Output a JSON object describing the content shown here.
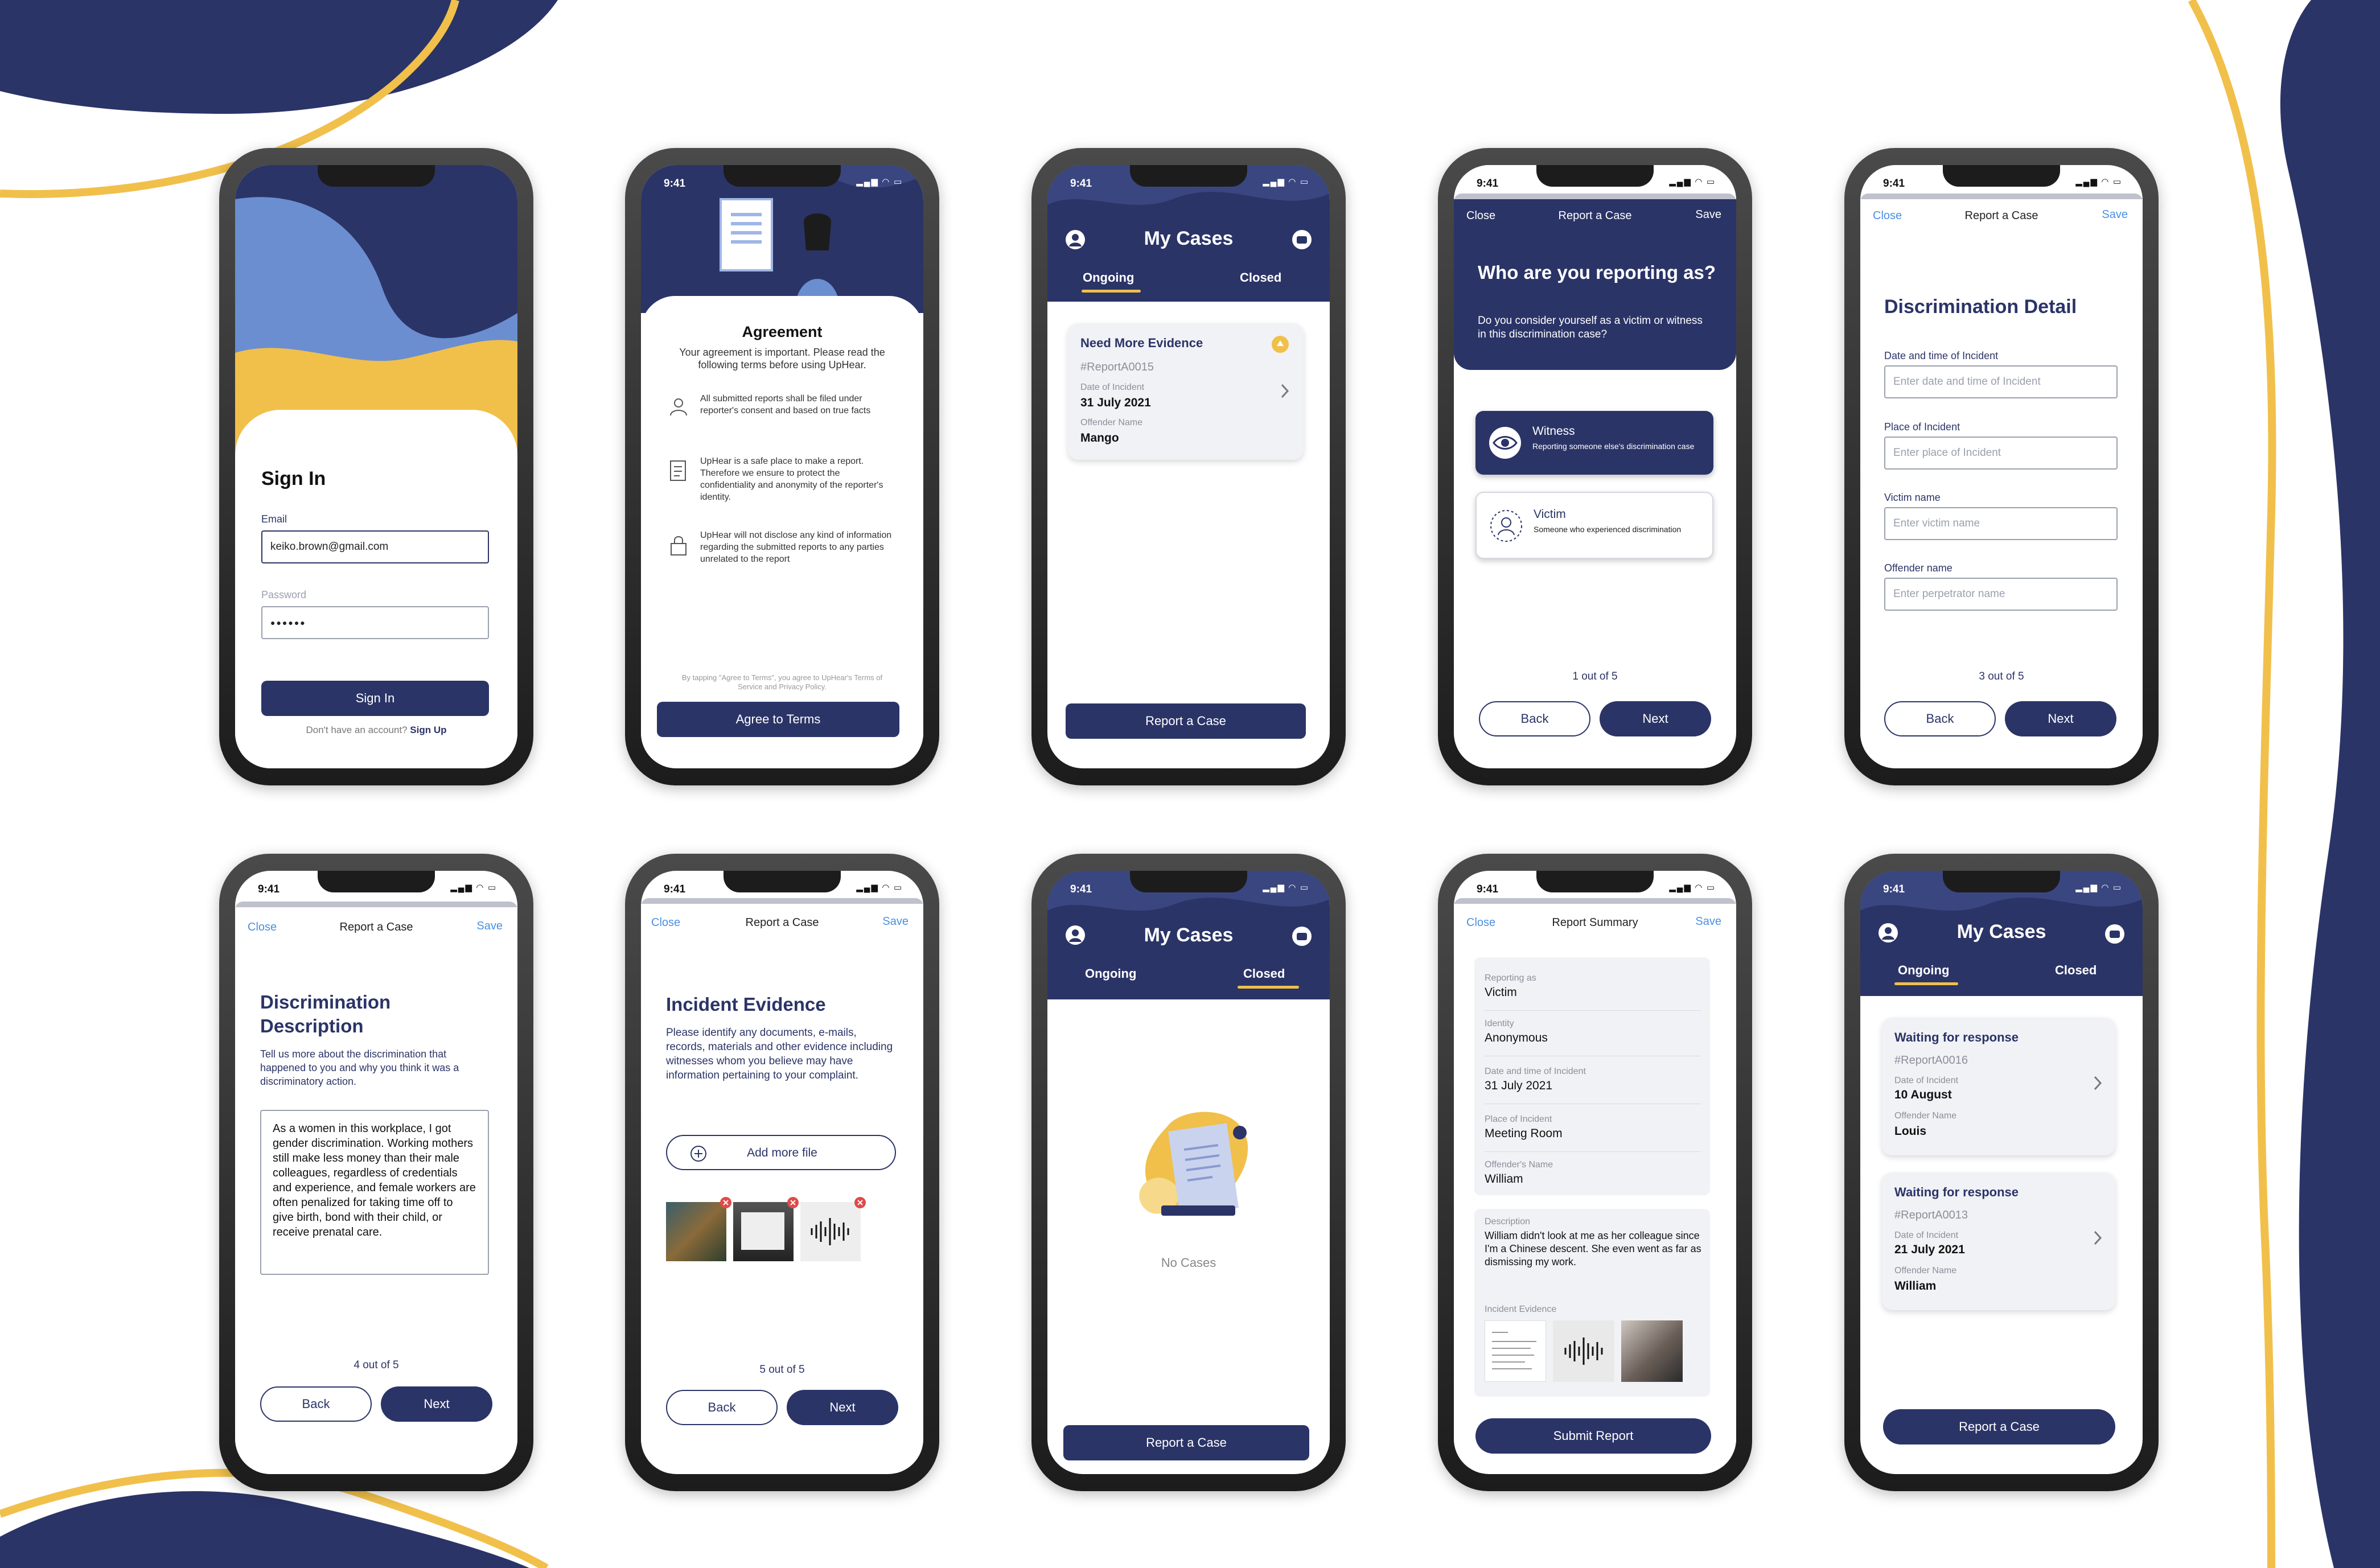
{
  "status_time": "9:41",
  "colors": {
    "navy": "#2b3467",
    "yellow": "#f1c04b",
    "blue_light": "#6b8ed0",
    "link": "#4a90e2"
  },
  "signin": {
    "title": "Sign In",
    "email_label": "Email",
    "email_value": "keiko.brown@gmail.com",
    "password_label": "Password",
    "password_value": "●●●●●●",
    "button": "Sign In",
    "footer": "Don't have an account?",
    "footer_link": "Sign Up"
  },
  "agreement": {
    "title": "Agreement",
    "intro": "Your agreement is important. Please read the following terms before using UpHear.",
    "items": [
      {
        "icon": "person-icon",
        "text": "All submitted reports shall be filed under reporter's consent and based on true facts"
      },
      {
        "icon": "document-icon",
        "text": "UpHear is a safe place to make a report. Therefore we ensure to protect the confidentiality and anonymity of the reporter's identity."
      },
      {
        "icon": "lock-icon",
        "text": "UpHear will not disclose any kind of information regarding the submitted reports to any parties unrelated to the report"
      }
    ],
    "fine_print": "By tapping \"Agree to Terms\", you agree to UpHear's Terms of Service and Privacy Policy.",
    "button": "Agree to Terms"
  },
  "cases1": {
    "title": "My Cases",
    "tab_ongoing": "Ongoing",
    "tab_closed": "Closed",
    "card": {
      "status": "Need More Evidence",
      "id": "#ReportA0015",
      "date_label": "Date of Incident",
      "date": "31 July 2021",
      "offender_label": "Offender Name",
      "offender": "Mango"
    },
    "button": "Report a Case"
  },
  "report_header": {
    "close": "Close",
    "title": "Report a Case",
    "save": "Save"
  },
  "step1": {
    "title": "Who are you reporting as?",
    "subtitle": "Do you consider yourself as a victim or witness in this discrimination case?",
    "option1_title": "Witness",
    "option1_desc": "Reporting someone else's discrimination case",
    "option2_title": "Victim",
    "option2_desc": "Someone who experienced discrimination",
    "progress": "1 out of 5",
    "back": "Back",
    "next": "Next"
  },
  "step3": {
    "title": "Discrimination Detail",
    "date_label": "Date and time of Incident",
    "date_ph": "Enter date and time of Incident",
    "place_label": "Place of Incident",
    "place_ph": "Enter place of Incident",
    "victim_label": "Victim name",
    "victim_ph": "Enter victim name",
    "offender_label": "Offender name",
    "offender_ph": "Enter perpetrator name",
    "progress": "3 out of 5",
    "back": "Back",
    "next": "Next"
  },
  "step4": {
    "title": "Discrimination Description",
    "subtitle": "Tell us more about the discrimination that happened to you and why you think it was a discriminatory action.",
    "text": "As a women in this workplace, I got gender discrimination. Working mothers still make less money than their male colleagues, regardless of credentials and experience, and female workers are often penalized for taking time off to give birth, bond with their child, or receive prenatal care.",
    "progress": "4 out of 5",
    "back": "Back",
    "next": "Next"
  },
  "step5": {
    "title": "Incident Evidence",
    "subtitle": "Please identify any documents, e-mails, records, materials and other evidence including witnesses whom you believe may have information pertaining to your complaint.",
    "add_file": "Add more file",
    "progress": "5 out of 5",
    "back": "Back",
    "next": "Next"
  },
  "cases2": {
    "title": "My Cases",
    "tab_ongoing": "Ongoing",
    "tab_closed": "Closed",
    "empty": "No Cases",
    "button": "Report a Case"
  },
  "summary": {
    "close": "Close",
    "title": "Report Summary",
    "save": "Save",
    "rows": [
      {
        "label": "Reporting as",
        "value": "Victim"
      },
      {
        "label": "Identity",
        "value": "Anonymous"
      },
      {
        "label": "Date and time of Incident",
        "value": "31 July 2021"
      },
      {
        "label": "Place of Incident",
        "value": "Meeting Room"
      },
      {
        "label": "Offender's Name",
        "value": "William"
      }
    ],
    "desc_label": "Description",
    "desc_text": "William didn't look at me as her colleague since I'm a Chinese descent. She even went as far as dismissing my work.",
    "evidence_label": "Incident Evidence",
    "button": "Submit Report"
  },
  "cases3": {
    "title": "My Cases",
    "tab_ongoing": "Ongoing",
    "tab_closed": "Closed",
    "cards": [
      {
        "status": "Waiting for response",
        "id": "#ReportA0016",
        "date_label": "Date of Incident",
        "date": "10 August",
        "offender_label": "Offender Name",
        "offender": "Louis"
      },
      {
        "status": "Waiting for response",
        "id": "#ReportA0013",
        "date_label": "Date of Incident",
        "date": "21 July 2021",
        "offender_label": "Offender Name",
        "offender": "William"
      }
    ],
    "button": "Report a Case"
  }
}
